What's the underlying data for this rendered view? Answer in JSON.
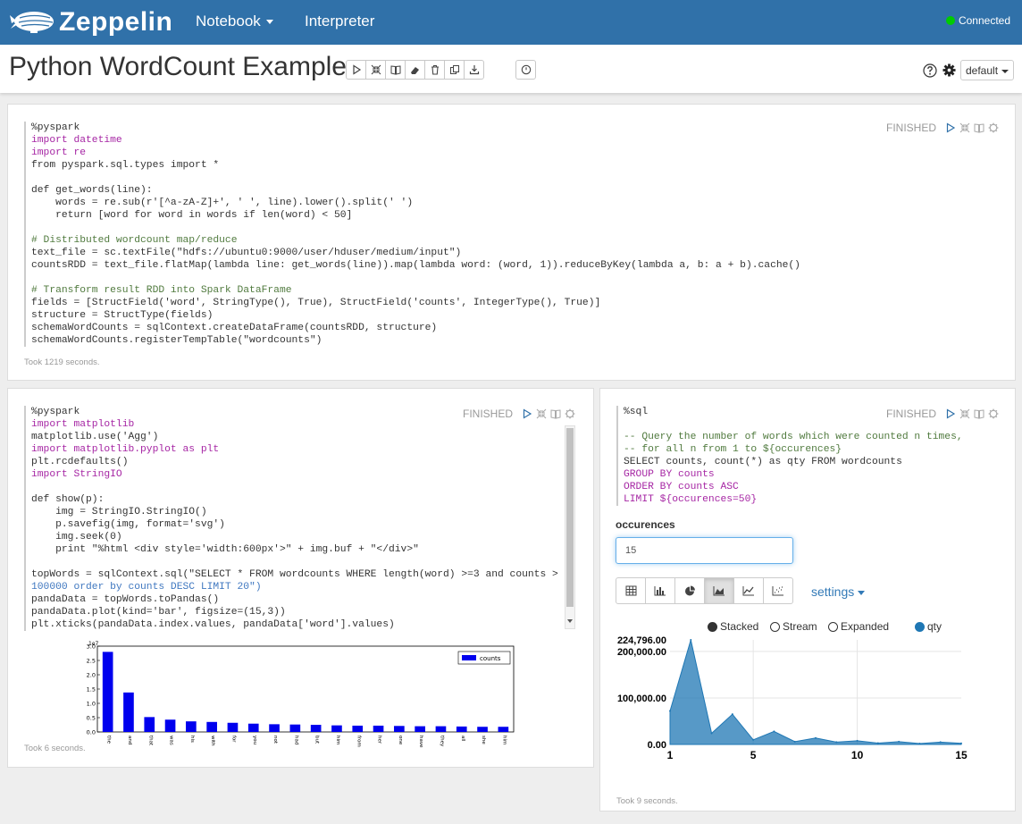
{
  "topnav": {
    "brand": "Zeppelin",
    "menu": [
      "Notebook",
      "Interpreter"
    ],
    "connection_status": "Connected"
  },
  "notebook": {
    "title": "Python WordCount Example",
    "mode_dropdown": "default"
  },
  "paragraphs": [
    {
      "status": "FINISHED",
      "took": "Took 1219 seconds.",
      "code_lines": [
        "%pyspark",
        "import datetime",
        "import re",
        "from pyspark.sql.types import *",
        "",
        "def get_words(line):",
        "    words = re.sub(r'[^a-zA-Z]+', ' ', line).lower().split(' ')",
        "    return [word for word in words if len(word) < 50]",
        "",
        "# Distributed wordcount map/reduce",
        "text_file = sc.textFile(\"hdfs://ubuntu0:9000/user/hduser/medium/input\")",
        "countsRDD = text_file.flatMap(lambda line: get_words(line)).map(lambda word: (word, 1)).reduceByKey(lambda a, b: a + b).cache()",
        "",
        "# Transform result RDD into Spark DataFrame",
        "fields = [StructField('word', StringType(), True), StructField('counts', IntegerType(), True)]",
        "structure = StructType(fields)",
        "schemaWordCounts = sqlContext.createDataFrame(countsRDD, structure)",
        "schemaWordCounts.registerTempTable(\"wordcounts\")"
      ]
    },
    {
      "status": "FINISHED",
      "took": "Took 6 seconds.",
      "code_lines": [
        "%pyspark",
        "import matplotlib",
        "matplotlib.use('Agg')",
        "import matplotlib.pyplot as plt",
        "plt.rcdefaults()",
        "import StringIO",
        "",
        "def show(p):",
        "    img = StringIO.StringIO()",
        "    p.savefig(img, format='svg')",
        "    img.seek(0)",
        "    print \"%html <div style='width:600px'>\" + img.buf + \"</div>\"",
        "",
        "topWords = sqlContext.sql(\"SELECT * FROM wordcounts WHERE length(word) >=3 and counts >",
        "100000 order by counts DESC LIMIT 20\")",
        "pandaData = topWords.toPandas()",
        "pandaData.plot(kind='bar', figsize=(15,3))",
        "plt.xticks(pandaData.index.values, pandaData['word'].values)"
      ]
    },
    {
      "status": "FINISHED",
      "took": "Took 9 seconds.",
      "code_lines": [
        "%sql",
        "",
        "-- Query the number of words which were counted n times,",
        "-- for all n from 1 to ${occurences}",
        "SELECT counts, count(*) as qty FROM wordcounts",
        "GROUP BY counts",
        "ORDER BY counts ASC",
        "LIMIT ${occurences=50}"
      ],
      "form": {
        "label": "occurences",
        "value": "15"
      },
      "settings_label": "settings",
      "display_options": [
        "Stacked",
        "Stream",
        "Expanded"
      ],
      "legend": "qty"
    }
  ],
  "chart_data": [
    {
      "type": "bar",
      "legend": [
        "counts"
      ],
      "y_exponent": "1e7",
      "ylim": [
        0,
        3.0
      ],
      "yticks": [
        "0.0",
        "0.5",
        "1.0",
        "1.5",
        "2.0",
        "2.5",
        "3.0"
      ],
      "categories": [
        "the",
        "and",
        "that",
        "was",
        "his",
        "with",
        "for",
        "you",
        "not",
        "had",
        "but",
        "him",
        "from",
        "her",
        "one",
        "have",
        "they",
        "all",
        "she",
        "him"
      ],
      "series": [
        {
          "name": "counts",
          "values": [
            2.8,
            1.38,
            0.52,
            0.43,
            0.37,
            0.35,
            0.32,
            0.29,
            0.27,
            0.26,
            0.25,
            0.23,
            0.22,
            0.22,
            0.21,
            0.2,
            0.2,
            0.19,
            0.18,
            0.18
          ]
        }
      ],
      "colors": {
        "bar": "#0000ee"
      }
    },
    {
      "type": "area",
      "x": [
        1,
        2,
        3,
        4,
        5,
        6,
        7,
        8,
        9,
        10,
        11,
        12,
        13,
        14,
        15
      ],
      "series": [
        {
          "name": "qty",
          "values": [
            72000,
            224796,
            24000,
            65000,
            10000,
            28000,
            6000,
            14000,
            5000,
            8000,
            3000,
            6000,
            2000,
            5000,
            2500
          ]
        }
      ],
      "xticks": [
        "1",
        "5",
        "10",
        "15"
      ],
      "yticks": [
        "0.00",
        "100,000.00",
        "200,000.00",
        "224,796.00"
      ],
      "ylim": [
        0,
        224796
      ],
      "colors": {
        "area": "#1f77b4"
      }
    }
  ]
}
